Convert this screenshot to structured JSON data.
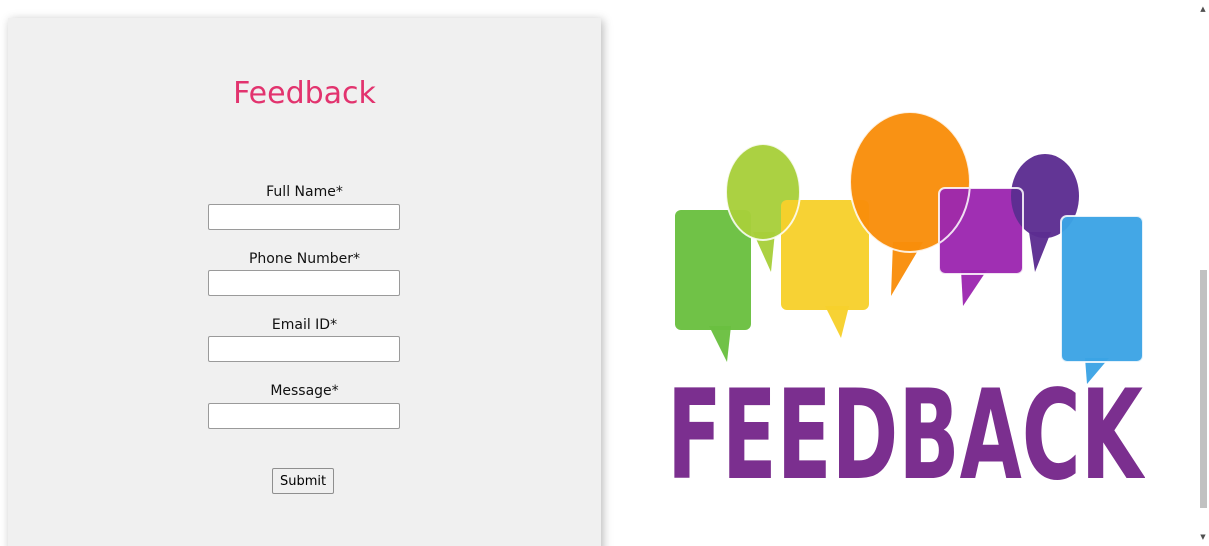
{
  "form": {
    "title": "Feedback",
    "fields": [
      {
        "label": "Full Name*",
        "value": "",
        "placeholder": ""
      },
      {
        "label": "Phone Number*",
        "value": "",
        "placeholder": ""
      },
      {
        "label": "Email ID*",
        "value": "",
        "placeholder": ""
      },
      {
        "label": "Message*",
        "value": "",
        "placeholder": ""
      }
    ],
    "submit_label": "Submit"
  },
  "illustration": {
    "word": "FEEDBACK",
    "word_colors": [
      "#7cc242",
      "#5b3b8f",
      "#e83e8c",
      "#f28c28",
      "#ec1c3a",
      "#c2185b",
      "#8a2be2",
      "#f47c20",
      "#3aa0dc"
    ],
    "bubble_colors": [
      "#6abf40",
      "#a8cf3a",
      "#f7d02c",
      "#f98e0a",
      "#9c27b0",
      "#5c2d91",
      "#3ba3e5"
    ]
  },
  "scrollbar": {
    "up_icon": "scroll-up-arrow-icon",
    "down_icon": "scroll-down-arrow-icon"
  },
  "colors": {
    "title": "#e2336e",
    "card_bg": "#f0f0f0"
  }
}
